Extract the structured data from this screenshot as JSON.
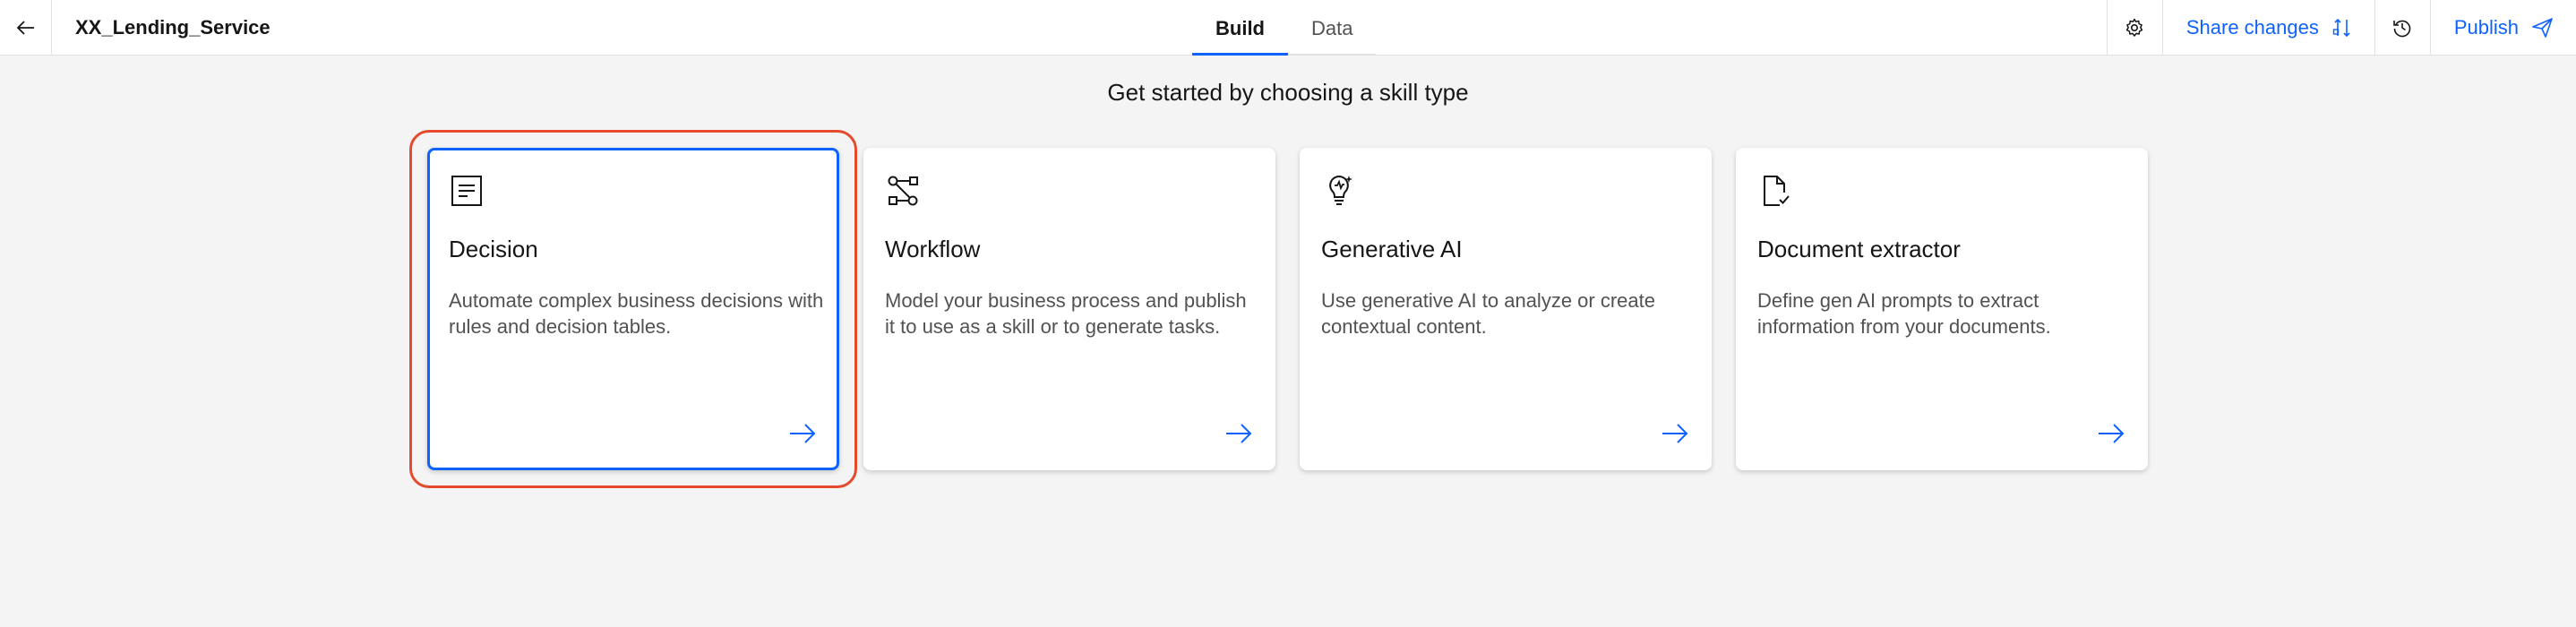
{
  "header": {
    "app_title": "XX_Lending_Service",
    "tabs": [
      {
        "label": "Build",
        "active": true
      },
      {
        "label": "Data",
        "active": false
      }
    ],
    "share_label": "Share changes",
    "publish_label": "Publish"
  },
  "main": {
    "prompt": "Get started by choosing a skill type",
    "cards": [
      {
        "title": "Decision",
        "description": "Automate complex business decisions with rules and decision tables.",
        "icon": "document-list-icon",
        "selected": true
      },
      {
        "title": "Workflow",
        "description": "Model your business process and publish it to use as a skill or to generate tasks.",
        "icon": "workflow-icon",
        "selected": false
      },
      {
        "title": "Generative AI",
        "description": "Use generative AI to analyze or create contextual content.",
        "icon": "lightbulb-ai-icon",
        "selected": false
      },
      {
        "title": "Document extractor",
        "description": "Define gen AI prompts to extract information from your documents.",
        "icon": "document-check-icon",
        "selected": false
      }
    ]
  },
  "colors": {
    "accent": "#0f62fe",
    "highlight": "#e64a2e",
    "background": "#f4f4f4"
  }
}
